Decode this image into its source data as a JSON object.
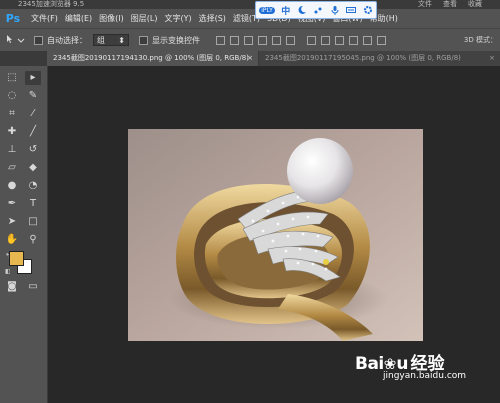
{
  "browser": {
    "title": "2345加速浏览器 9.5",
    "links": [
      "文件",
      "查看",
      "收藏"
    ]
  },
  "ime_toolbar": {
    "badge": "iPLY",
    "mode": "中",
    "icons": [
      "moon-icon",
      "punctuation-icon",
      "microphone-icon",
      "keyboard-icon",
      "settings-icon"
    ]
  },
  "menubar": {
    "logo": "Ps",
    "items": [
      "文件(F)",
      "编辑(E)",
      "图像(I)",
      "图层(L)",
      "文字(Y)",
      "选择(S)",
      "滤镜(T)",
      "3D(D)",
      "视图(V)",
      "窗口(W)",
      "帮助(H)"
    ]
  },
  "options_bar": {
    "auto_select_label": "自动选择：",
    "auto_select_value": "组",
    "show_transform_label": "显示变换控件",
    "mode_3d_label": "3D 模式："
  },
  "tabs": [
    {
      "label": "2345截图20190117194130.png @ 100% (图层 0, RGB/8)",
      "active": true
    },
    {
      "label": "2345截图20190117195045.png @ 100% (图层 0, RGB/8)",
      "active": false
    }
  ],
  "tab_close": "×",
  "colors": {
    "foreground": "#e7b84f",
    "background": "#ffffff",
    "accent": "#31a8ff"
  },
  "watermark": {
    "brand": "Bai",
    "brand_tail": "u",
    "cn": "经验",
    "url": "jingyan.baidu.com"
  }
}
